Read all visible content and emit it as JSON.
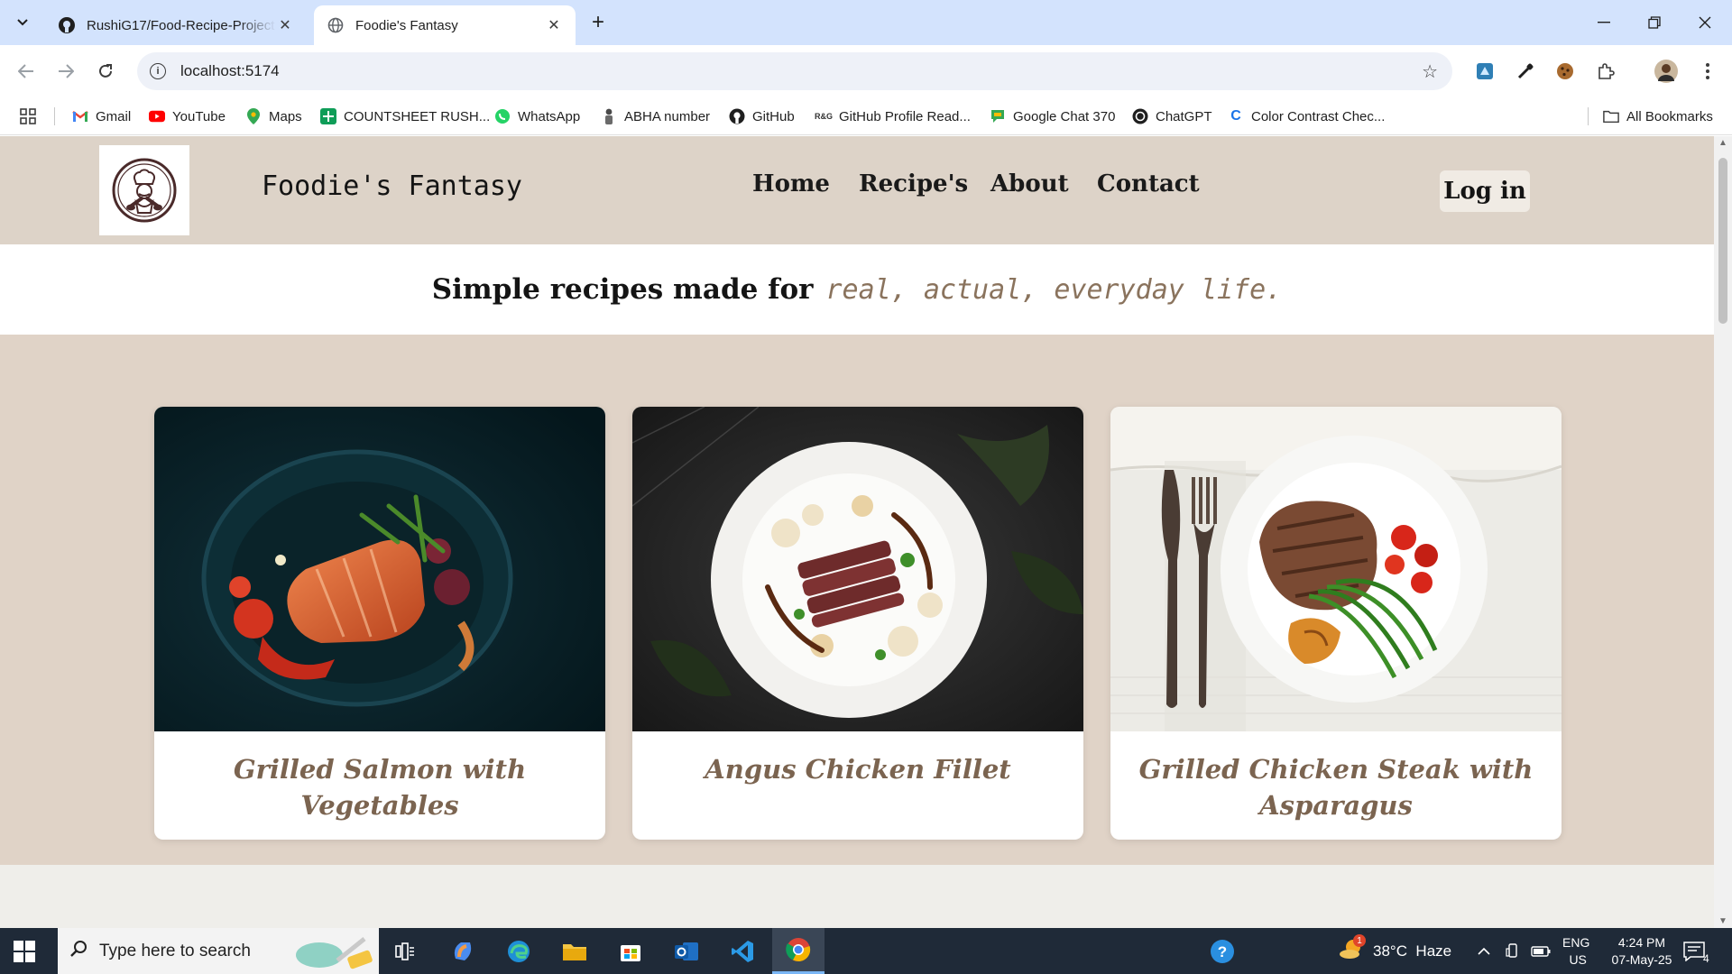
{
  "browser": {
    "tabs": [
      {
        "title": "RushiG17/Food-Recipe-Project",
        "favicon": "github-icon"
      },
      {
        "title": "Foodie's Fantasy",
        "favicon": "globe-icon"
      }
    ],
    "url": "localhost:5174",
    "bookmarks": [
      {
        "label": "Gmail",
        "icon": "gmail-icon"
      },
      {
        "label": "YouTube",
        "icon": "youtube-icon"
      },
      {
        "label": "Maps",
        "icon": "maps-icon"
      },
      {
        "label": "COUNTSHEET RUSH...",
        "icon": "sheets-icon"
      },
      {
        "label": "WhatsApp",
        "icon": "whatsapp-icon"
      },
      {
        "label": "ABHA number",
        "icon": "abha-icon"
      },
      {
        "label": "GitHub",
        "icon": "github-icon"
      },
      {
        "label": "GitHub Profile Read...",
        "icon": "readme-icon"
      },
      {
        "label": "Google Chat 370",
        "icon": "chat-icon"
      },
      {
        "label": "ChatGPT",
        "icon": "chatgpt-icon"
      },
      {
        "label": "Color Contrast Chec...",
        "icon": "contrast-icon"
      }
    ],
    "all_bookmarks": "All Bookmarks"
  },
  "site": {
    "brand": "Foodie's Fantasy",
    "nav": [
      "Home",
      "Recipe's",
      "About",
      "Contact"
    ],
    "login": "Log in",
    "tagline_strong": "Simple recipes made for",
    "tagline_em": "real, actual, everyday life.",
    "recipes": [
      {
        "title": "Grilled Salmon with Vegetables"
      },
      {
        "title": "Angus Chicken Fillet"
      },
      {
        "title": "Grilled Chicken Steak with Asparagus"
      }
    ]
  },
  "taskbar": {
    "search_placeholder": "Type here to search",
    "weather": "38°C  Haze",
    "weather_badge": "1",
    "lang_top": "ENG",
    "lang_bottom": "US",
    "time": "4:24 PM",
    "date": "07-May-25",
    "notifications": "4"
  },
  "colors": {
    "header_bg": "#ddd3c8",
    "cards_band_bg": "#e0d3c7",
    "accent_text": "#7b6450"
  }
}
